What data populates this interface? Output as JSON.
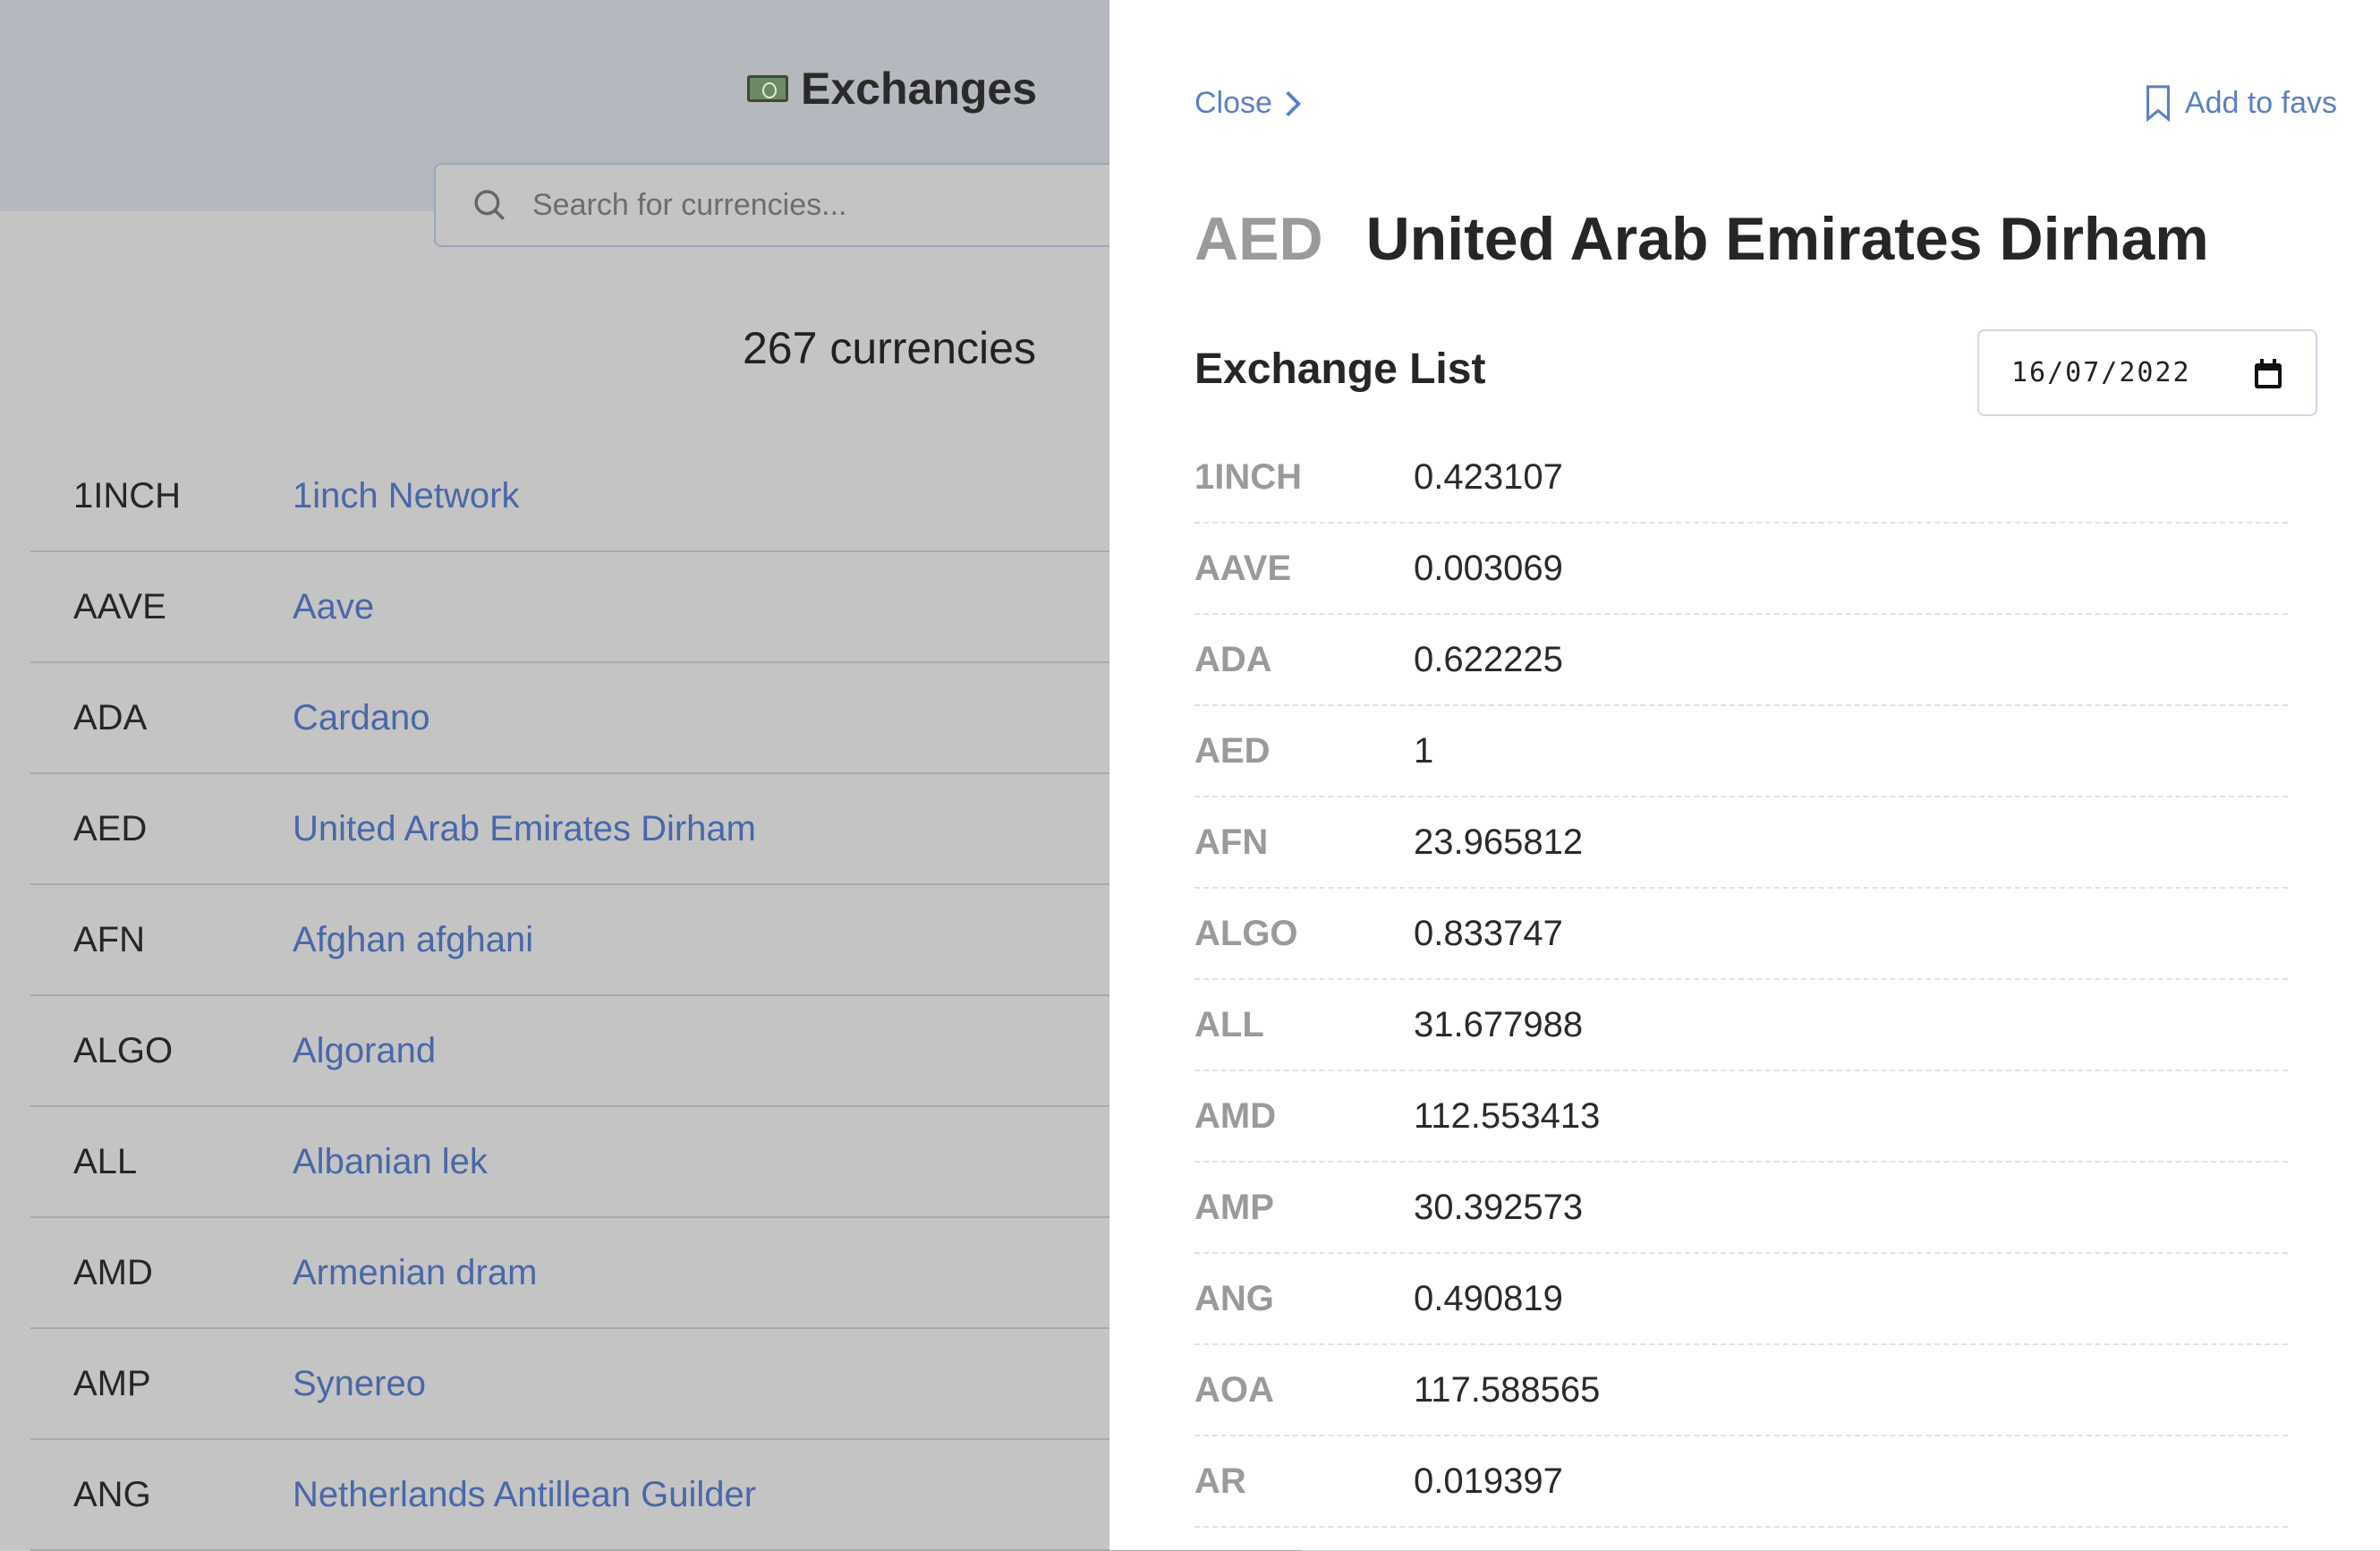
{
  "header": {
    "title": "Exchanges",
    "title_icon": "money-bill-icon"
  },
  "search": {
    "placeholder": "Search for currencies...",
    "value": ""
  },
  "count_label": "267 currencies",
  "currencies": [
    {
      "code": "1INCH",
      "name": "1inch Network"
    },
    {
      "code": "AAVE",
      "name": "Aave"
    },
    {
      "code": "ADA",
      "name": "Cardano"
    },
    {
      "code": "AED",
      "name": "United Arab Emirates Dirham"
    },
    {
      "code": "AFN",
      "name": "Afghan afghani"
    },
    {
      "code": "ALGO",
      "name": "Algorand"
    },
    {
      "code": "ALL",
      "name": "Albanian lek"
    },
    {
      "code": "AMD",
      "name": "Armenian dram"
    },
    {
      "code": "AMP",
      "name": "Synereo"
    },
    {
      "code": "ANG",
      "name": "Netherlands Antillean Guilder"
    }
  ],
  "drawer": {
    "close_label": "Close",
    "fav_label": "Add to favs",
    "code": "AED",
    "name": "United Arab Emirates Dirham",
    "exchange_title": "Exchange List",
    "date_value": "16/07/2022",
    "rates": [
      {
        "code": "1INCH",
        "value": "0.423107"
      },
      {
        "code": "AAVE",
        "value": "0.003069"
      },
      {
        "code": "ADA",
        "value": "0.622225"
      },
      {
        "code": "AED",
        "value": "1"
      },
      {
        "code": "AFN",
        "value": "23.965812"
      },
      {
        "code": "ALGO",
        "value": "0.833747"
      },
      {
        "code": "ALL",
        "value": "31.677988"
      },
      {
        "code": "AMD",
        "value": "112.553413"
      },
      {
        "code": "AMP",
        "value": "30.392573"
      },
      {
        "code": "ANG",
        "value": "0.490819"
      },
      {
        "code": "AOA",
        "value": "117.588565"
      },
      {
        "code": "AR",
        "value": "0.019397"
      }
    ]
  },
  "colors": {
    "link": "#4a67a8",
    "accent": "#5a7fc6",
    "muted_code": "#9a9a9a"
  }
}
